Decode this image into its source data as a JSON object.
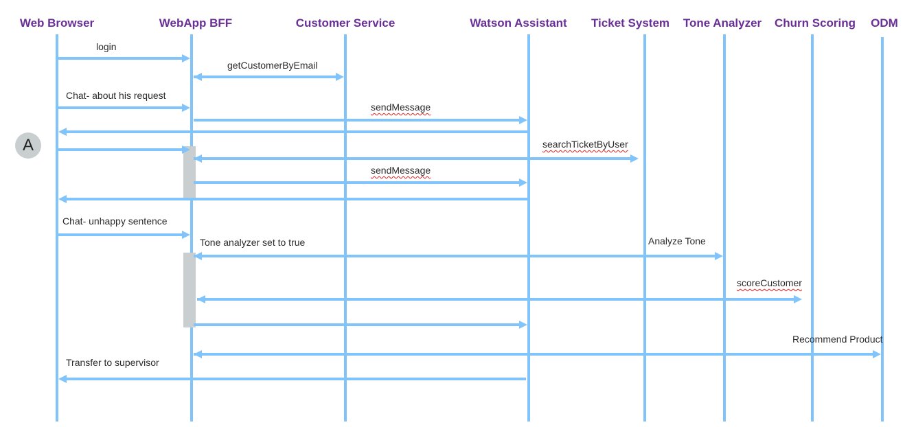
{
  "diagram": {
    "type": "sequence",
    "line_color": "#80c4fb",
    "participant_color": "#6a2f97",
    "activation_color": "#c9cfd0",
    "participants": [
      {
        "id": "browser",
        "label": "Web Browser"
      },
      {
        "id": "bff",
        "label": "WebApp BFF"
      },
      {
        "id": "customer",
        "label": "Customer Service"
      },
      {
        "id": "watson",
        "label": "Watson Assistant"
      },
      {
        "id": "ticket",
        "label": "Ticket System"
      },
      {
        "id": "tone",
        "label": "Tone Analyzer"
      },
      {
        "id": "churn",
        "label": "Churn Scoring"
      },
      {
        "id": "odm",
        "label": "ODM"
      }
    ],
    "marker": {
      "label": "A"
    },
    "messages": [
      {
        "from": "browser",
        "to": "bff",
        "label": "login",
        "bidirectional": false,
        "spellcheck": false
      },
      {
        "from": "bff",
        "to": "customer",
        "label": "getCustomerByEmail",
        "bidirectional": true,
        "spellcheck": false
      },
      {
        "from": "browser",
        "to": "bff",
        "label": "Chat- about his request",
        "bidirectional": false,
        "spellcheck": false
      },
      {
        "from": "bff",
        "to": "watson",
        "label": "sendMessage",
        "bidirectional": false,
        "spellcheck": true
      },
      {
        "from": "watson",
        "to": "browser",
        "label": "",
        "bidirectional": false,
        "spellcheck": false
      },
      {
        "from": "browser",
        "to": "bff",
        "label": "",
        "bidirectional": false,
        "spellcheck": false
      },
      {
        "from": "bff",
        "to": "ticket",
        "label": "searchTicketByUser",
        "bidirectional": true,
        "spellcheck": true
      },
      {
        "from": "bff",
        "to": "watson",
        "label": "sendMessage",
        "bidirectional": false,
        "spellcheck": true
      },
      {
        "from": "watson",
        "to": "browser",
        "label": "",
        "bidirectional": false,
        "spellcheck": false
      },
      {
        "from": "browser",
        "to": "bff",
        "label": "Chat- unhappy sentence",
        "bidirectional": false,
        "spellcheck": false
      },
      {
        "from": "bff",
        "to": "tone",
        "label": "Tone analyzer set to true",
        "label2": "Analyze Tone",
        "bidirectional": true,
        "spellcheck": false
      },
      {
        "from": "bff",
        "to": "churn",
        "label": "scoreCustomer",
        "bidirectional": true,
        "spellcheck": true
      },
      {
        "from": "bff",
        "to": "watson",
        "label": "",
        "bidirectional": false,
        "spellcheck": false
      },
      {
        "from": "bff",
        "to": "odm",
        "label": "Recommend Product",
        "bidirectional": true,
        "spellcheck": false
      },
      {
        "from": "watson",
        "to": "browser",
        "label": "Transfer to supervisor",
        "bidirectional": false,
        "spellcheck": false
      }
    ],
    "activations": [
      {
        "participant": "bff",
        "from_message": 5,
        "to_message": 8
      },
      {
        "participant": "bff",
        "from_message": 10,
        "to_message": 12
      }
    ]
  }
}
